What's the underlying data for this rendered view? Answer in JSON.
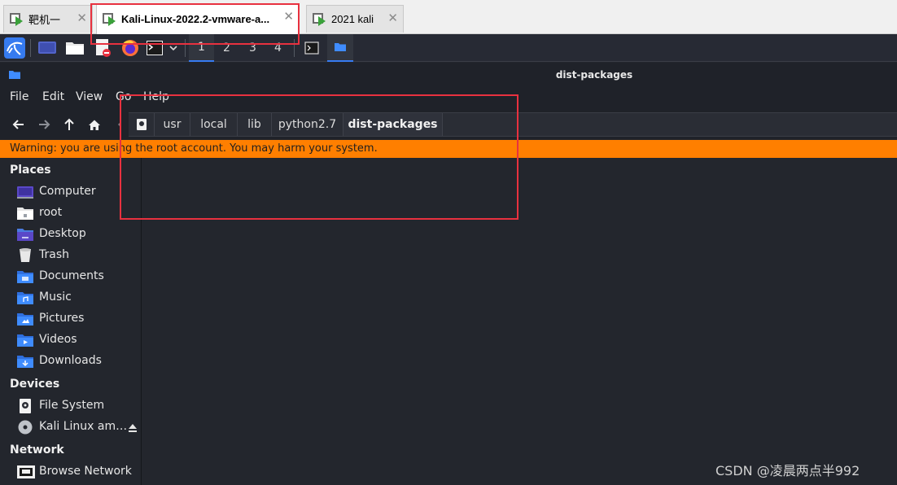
{
  "vm_tabs": [
    {
      "label": "靶机一",
      "active": false
    },
    {
      "label": "Kali-Linux-2022.2-vmware-a...",
      "active": true
    },
    {
      "label": "2021 kali",
      "active": false
    }
  ],
  "panel": {
    "workspaces": [
      "1",
      "2",
      "3",
      "4"
    ],
    "current_workspace": "1"
  },
  "window": {
    "title": "dist-packages"
  },
  "menu": {
    "file": "File",
    "edit": "Edit",
    "view": "View",
    "go": "Go",
    "help": "Help"
  },
  "pathbar": {
    "crumbs": [
      "usr",
      "local",
      "lib",
      "python2.7",
      "dist-packages"
    ]
  },
  "warning": {
    "text": "Warning: you are using the root account. You may harm your system."
  },
  "sidebar": {
    "places_heading": "Places",
    "places": [
      {
        "label": "Computer",
        "icon": "computer-icon"
      },
      {
        "label": "root",
        "icon": "home-folder-icon"
      },
      {
        "label": "Desktop",
        "icon": "desktop-icon"
      },
      {
        "label": "Trash",
        "icon": "trash-icon"
      },
      {
        "label": "Documents",
        "icon": "documents-folder-icon"
      },
      {
        "label": "Music",
        "icon": "music-folder-icon"
      },
      {
        "label": "Pictures",
        "icon": "pictures-folder-icon"
      },
      {
        "label": "Videos",
        "icon": "videos-folder-icon"
      },
      {
        "label": "Downloads",
        "icon": "downloads-folder-icon"
      }
    ],
    "devices_heading": "Devices",
    "devices": [
      {
        "label": "File System",
        "icon": "drive-icon"
      },
      {
        "label": "Kali Linux am…",
        "icon": "optical-disc-icon"
      }
    ],
    "network_heading": "Network",
    "network": [
      {
        "label": "Browse Network",
        "icon": "network-icon"
      }
    ]
  },
  "colors": {
    "accent": "#367bf0",
    "warning": "#ff7f00",
    "annotation": "#e8313f"
  },
  "watermark": "CSDN @凌晨两点半992"
}
